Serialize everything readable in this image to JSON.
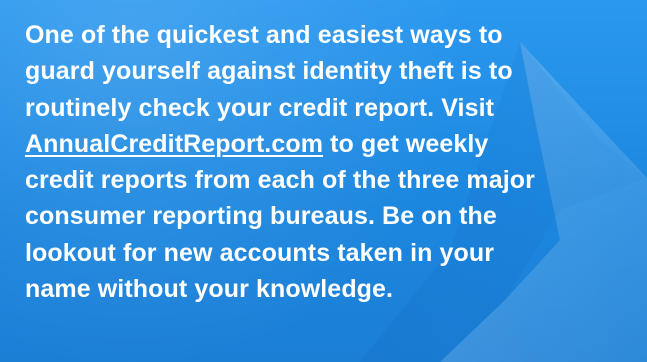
{
  "colors": {
    "background": "#1f8fe6",
    "text": "#ffffff"
  },
  "message": {
    "line1": "One of the quickest and easiest ways to",
    "line2": "guard yourself against identity theft is to",
    "line3": "routinely check your credit report. Visit",
    "link_text": "AnnualCreditReport.com",
    "line4_rest": " to get weekly",
    "line5": "credit reports from each of the three major",
    "line6": "consumer reporting bureaus. Be on the",
    "line7": "lookout for new accounts taken in your",
    "line8": "name without your knowledge."
  }
}
